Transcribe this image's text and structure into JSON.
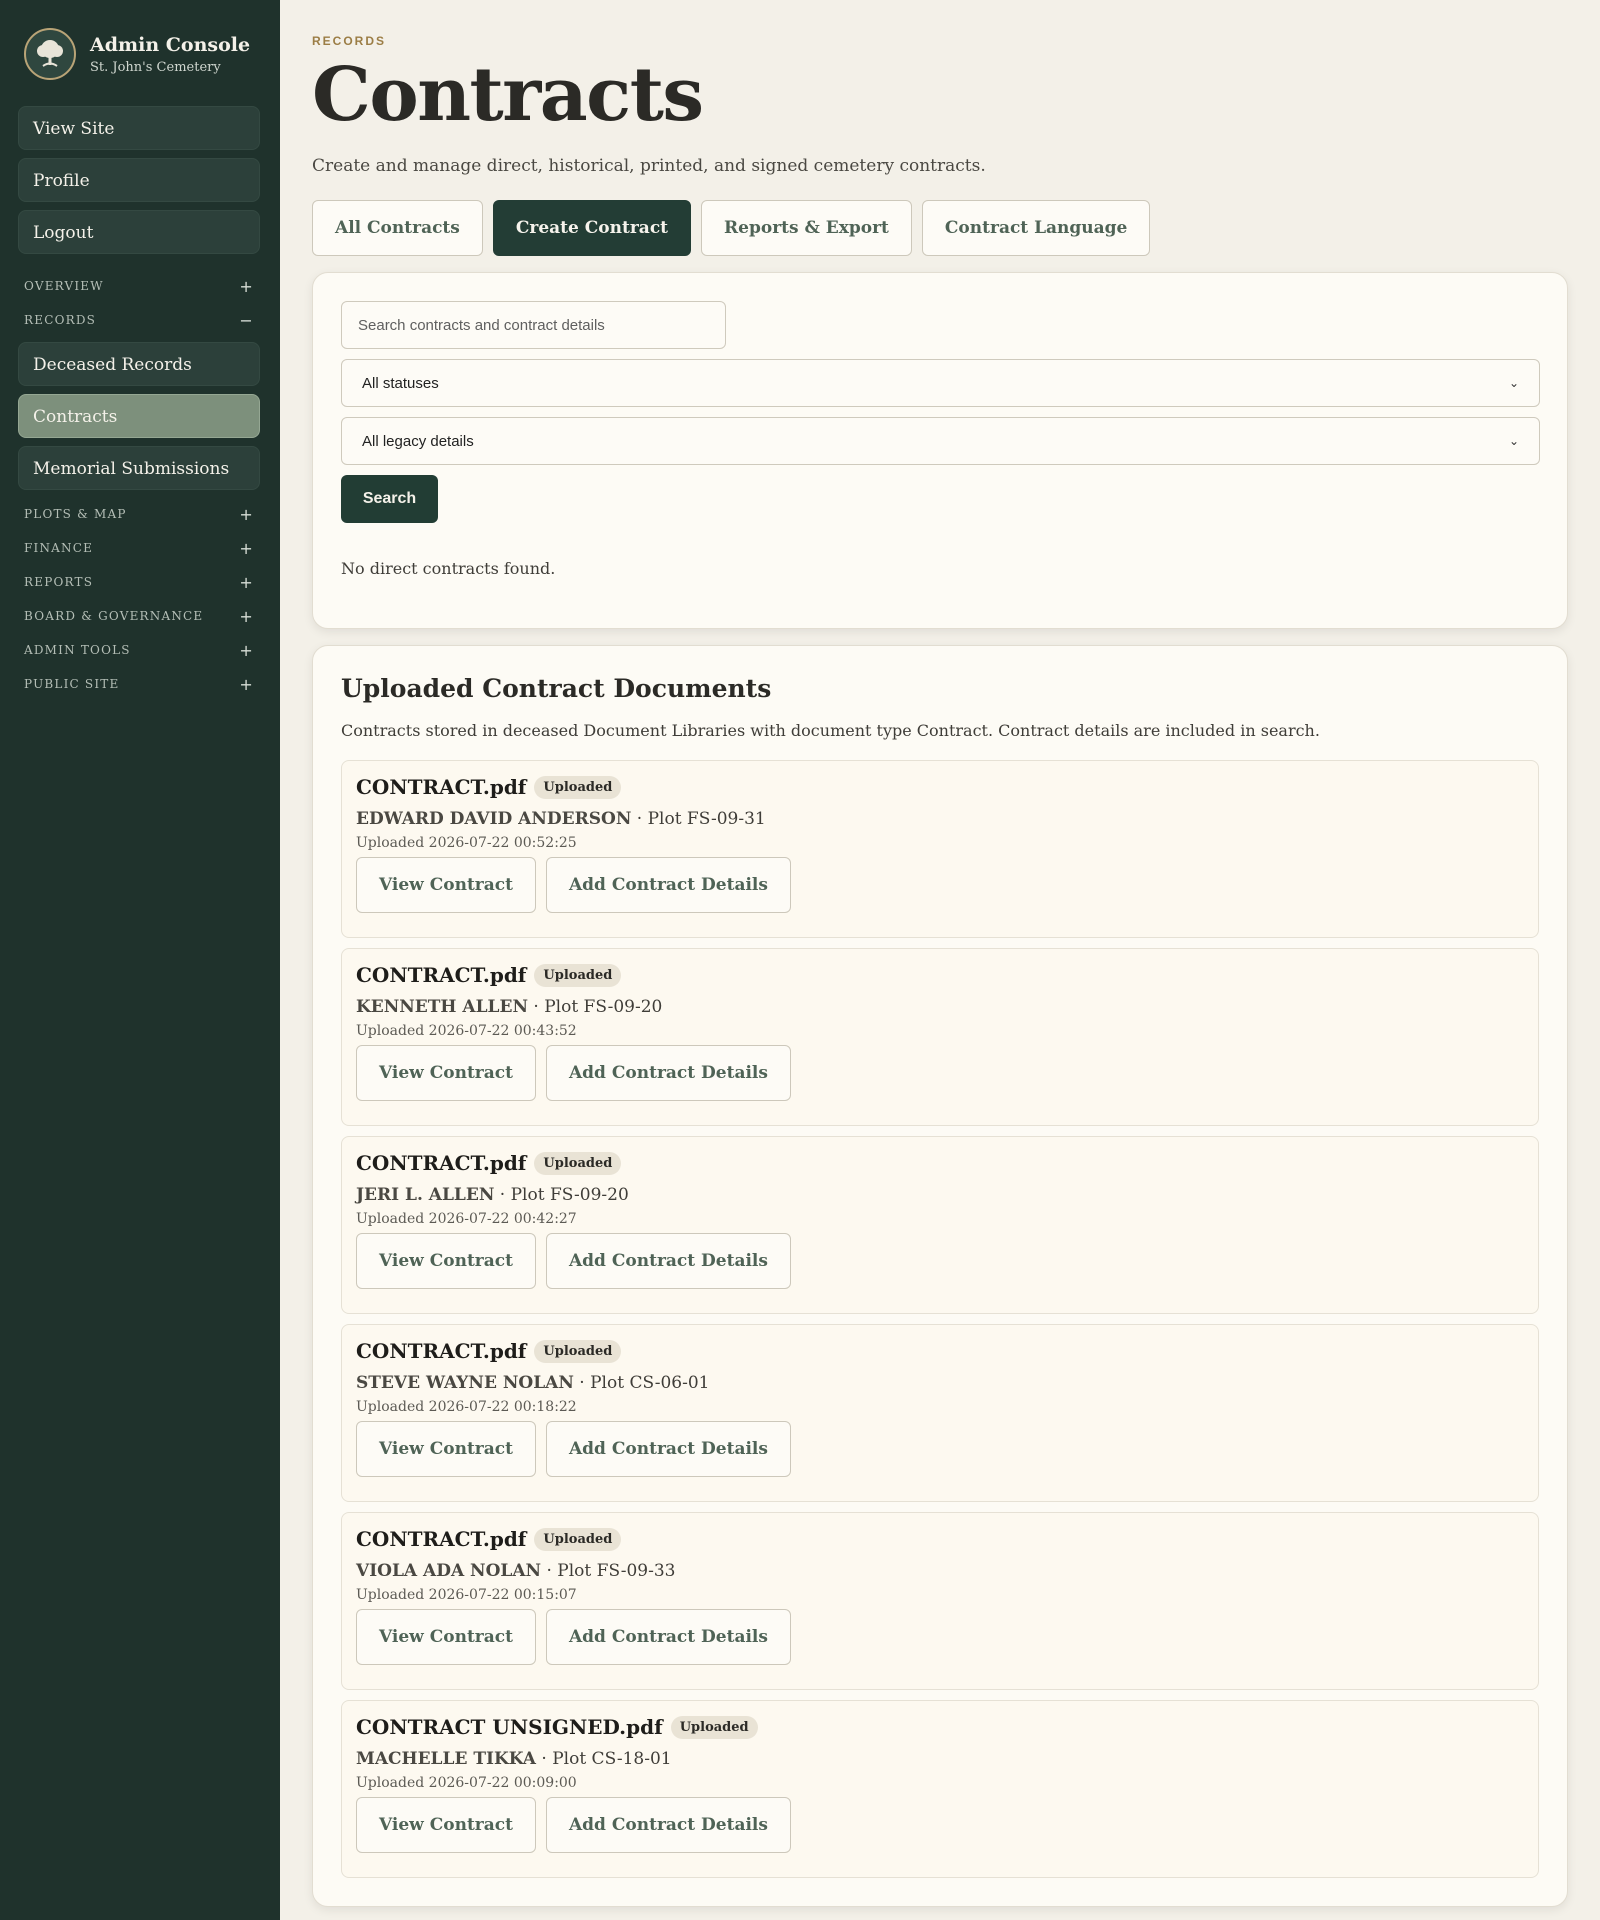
{
  "sidebar": {
    "brand_title": "Admin Console",
    "brand_subtitle": "St. John's Cemetery",
    "top_links": [
      "View Site",
      "Profile",
      "Logout"
    ],
    "sections": {
      "overview": {
        "label": "OVERVIEW",
        "toggle": "+"
      },
      "records": {
        "label": "RECORDS",
        "toggle": "−",
        "items": [
          "Deceased Records",
          "Contracts",
          "Memorial Submissions"
        ],
        "active": "Contracts"
      },
      "plots": {
        "label": "PLOTS & MAP",
        "toggle": "+"
      },
      "finance": {
        "label": "FINANCE",
        "toggle": "+"
      },
      "reports": {
        "label": "REPORTS",
        "toggle": "+"
      },
      "board": {
        "label": "BOARD & GOVERNANCE",
        "toggle": "+"
      },
      "admin": {
        "label": "ADMIN TOOLS",
        "toggle": "+"
      },
      "public": {
        "label": "PUBLIC SITE",
        "toggle": "+"
      }
    }
  },
  "header": {
    "eyebrow": "RECORDS",
    "title": "Contracts",
    "description": "Create and manage direct, historical, printed, and signed cemetery contracts."
  },
  "tabs": [
    "All Contracts",
    "Create Contract",
    "Reports & Export",
    "Contract Language"
  ],
  "active_tab": "Create Contract",
  "filters": {
    "search_placeholder": "Search contracts and contract details",
    "status_selected": "All statuses",
    "legacy_selected": "All legacy details",
    "search_label": "Search",
    "empty_message": "No direct contracts found."
  },
  "uploaded": {
    "title": "Uploaded Contract Documents",
    "description": "Contracts stored in deceased Document Libraries with document type Contract. Contract details are included in search.",
    "view_label": "View Contract",
    "add_label": "Add Contract Details",
    "docs": [
      {
        "file": "CONTRACT.pdf",
        "badge": "Uploaded",
        "name": "EDWARD DAVID ANDERSON",
        "plot": " · Plot FS-09-31",
        "date": "Uploaded 2026-07-22 00:52:25"
      },
      {
        "file": "CONTRACT.pdf",
        "badge": "Uploaded",
        "name": "KENNETH ALLEN",
        "plot": " · Plot FS-09-20",
        "date": "Uploaded 2026-07-22 00:43:52"
      },
      {
        "file": "CONTRACT.pdf",
        "badge": "Uploaded",
        "name": "JERI L. ALLEN",
        "plot": " · Plot FS-09-20",
        "date": "Uploaded 2026-07-22 00:42:27"
      },
      {
        "file": "CONTRACT.pdf",
        "badge": "Uploaded",
        "name": "STEVE WAYNE NOLAN",
        "plot": " · Plot CS-06-01",
        "date": "Uploaded 2026-07-22 00:18:22"
      },
      {
        "file": "CONTRACT.pdf",
        "badge": "Uploaded",
        "name": "VIOLA ADA NOLAN",
        "plot": " · Plot FS-09-33",
        "date": "Uploaded 2026-07-22 00:15:07"
      },
      {
        "file": "CONTRACT UNSIGNED.pdf",
        "badge": "Uploaded",
        "name": "MACHELLE TIKKA",
        "plot": " · Plot CS-18-01",
        "date": "Uploaded 2026-07-22 00:09:00"
      }
    ]
  },
  "colors": {
    "sidebar_bg": "#1f322c",
    "accent_dark_green": "#223d34",
    "active_sidebar": "#7d907c",
    "eyebrow": "#9b7d45",
    "page_bg": "#f3f0e8"
  }
}
